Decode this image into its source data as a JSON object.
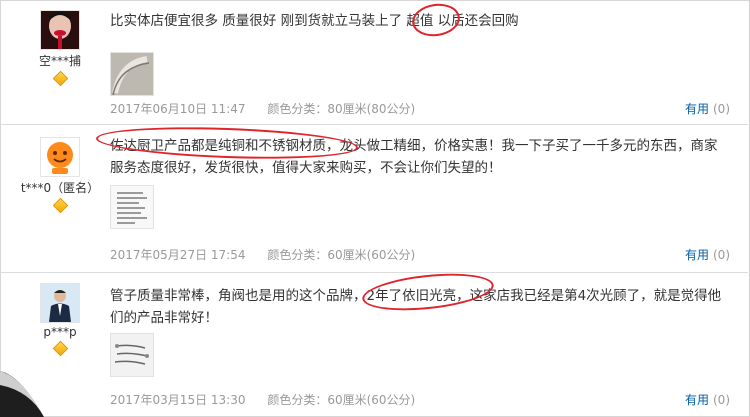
{
  "reviews": [
    {
      "username": "空***捕",
      "text": "比实体店便宜很多 质量很好 刚到货就立马装上了 超值 以后还会回购",
      "date": "2017年06月10日 11:47",
      "spec": "颜色分类：80厘米(80公分)",
      "useful_label": "有用",
      "useful_count": "(0)"
    },
    {
      "username": "t***0（匿名）",
      "text": "佐达厨卫产品都是纯铜和不锈钢材质，龙头做工精细，价格实惠！我一下子买了一千多元的东西，商家服务态度很好，发货很快，值得大家来购买，不会让你们失望的！",
      "date": "2017年05月27日 17:54",
      "spec": "颜色分类：60厘米(60公分)",
      "useful_label": "有用",
      "useful_count": "(0)"
    },
    {
      "username": "p***p",
      "text": "管子质量非常棒，角阀也是用的这个品牌，2年了依旧光亮，这家店我已经是第4次光顾了，就是觉得他们的产品非常好！",
      "date": "2017年03月15日 13:30",
      "spec": "颜色分类：60厘米(60公分)",
      "useful_label": "有用",
      "useful_count": "(0)"
    }
  ]
}
